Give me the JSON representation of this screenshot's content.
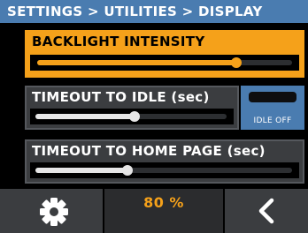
{
  "breadcrumb": "SETTINGS > UTILITIES > DISPLAY",
  "colors": {
    "accent": "#f5a11a",
    "header": "#4a7cb0",
    "panel": "#3b3d40"
  },
  "backlight": {
    "label": "BACKLIGHT INTENSITY",
    "level": 0.78
  },
  "timeout_idle": {
    "label": "TIMEOUT TO IDLE (sec)",
    "level": 0.52
  },
  "idle_toggle": {
    "label": "IDLE OFF"
  },
  "timeout_home": {
    "label": "TIMEOUT TO HOME PAGE (sec)",
    "level": 0.36
  },
  "footer": {
    "settings_icon": "gear-icon",
    "value": "80 %",
    "back_icon": "chevron-left-icon"
  }
}
